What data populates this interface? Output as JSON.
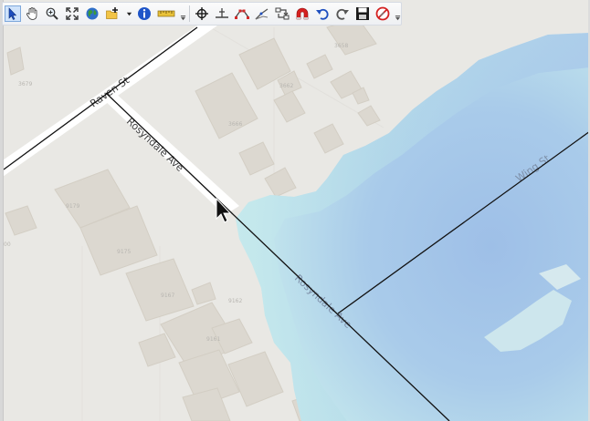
{
  "toolbar": {
    "tools": [
      {
        "id": "select",
        "icon": "select-arrow-icon",
        "active": true
      },
      {
        "id": "pan",
        "icon": "pan-hand-icon"
      },
      {
        "id": "zoom-in",
        "icon": "zoom-in-icon"
      },
      {
        "id": "full-extent",
        "icon": "full-extent-icon"
      },
      {
        "id": "globe",
        "icon": "globe-icon"
      },
      {
        "id": "add-data",
        "icon": "add-data-icon"
      },
      {
        "id": "identify",
        "icon": "identify-info-icon"
      },
      {
        "id": "measure",
        "icon": "measure-ruler-icon"
      },
      {
        "id": "snap-point",
        "icon": "crosshair-icon"
      },
      {
        "id": "split",
        "icon": "split-line-icon"
      },
      {
        "id": "edit-vertices",
        "icon": "edit-vertices-icon"
      },
      {
        "id": "reshape",
        "icon": "reshape-icon"
      },
      {
        "id": "transfer",
        "icon": "transfer-attributes-icon"
      },
      {
        "id": "snapping",
        "icon": "magnet-icon"
      },
      {
        "id": "undo",
        "icon": "undo-icon"
      },
      {
        "id": "redo",
        "icon": "redo-icon"
      },
      {
        "id": "save",
        "icon": "save-edits-icon"
      },
      {
        "id": "stop-editing",
        "icon": "stop-editing-icon"
      }
    ]
  },
  "map": {
    "streets": {
      "raven": "Raven St",
      "rosyndale_upper": "Rosyndale Ave",
      "rosyndale_lower": "Rosyndale Ave",
      "wing": "Wing St"
    },
    "addresses": [
      "3679",
      "3666",
      "3662",
      "3658",
      "9179",
      "9175",
      "9167",
      "9162",
      "9161",
      "00"
    ],
    "colors": {
      "background": "#e9e8e4",
      "building": "#dcd8d0",
      "building_edge": "#d2cdc3",
      "road": "#ffffff",
      "water_light": "#bfe3ea",
      "water_dark": "#9cbfe6",
      "parcel_line": "#000000"
    }
  }
}
